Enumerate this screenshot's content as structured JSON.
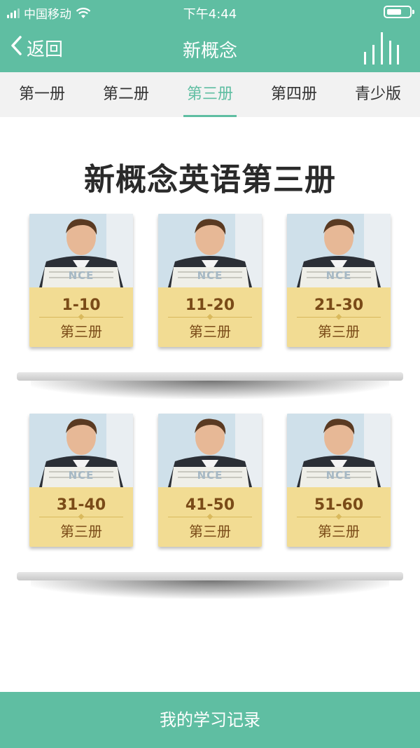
{
  "status_bar": {
    "carrier": "中国移动",
    "time": "下午4:44",
    "signal_icon": "signal-bars-icon",
    "wifi_icon": "wifi-icon",
    "battery_icon": "battery-icon"
  },
  "nav": {
    "back_label": "返回",
    "back_icon": "chevron-left-icon",
    "title": "新概念",
    "menu_icon": "audio-bars-icon"
  },
  "tabs": [
    {
      "label": "第一册",
      "active": false
    },
    {
      "label": "第二册",
      "active": false
    },
    {
      "label": "第三册",
      "active": true
    },
    {
      "label": "第四册",
      "active": false
    },
    {
      "label": "青少版",
      "active": false
    }
  ],
  "page_heading": "新概念英语第三册",
  "books": [
    {
      "cover_text": "NCE",
      "range": "1-10",
      "volume": "第三册"
    },
    {
      "cover_text": "NCE",
      "range": "11-20",
      "volume": "第三册"
    },
    {
      "cover_text": "NCE",
      "range": "21-30",
      "volume": "第三册"
    },
    {
      "cover_text": "NCE",
      "range": "31-40",
      "volume": "第三册"
    },
    {
      "cover_text": "NCE",
      "range": "41-50",
      "volume": "第三册"
    },
    {
      "cover_text": "NCE",
      "range": "51-60",
      "volume": "第三册"
    }
  ],
  "bottom_bar": {
    "label": "我的学习记录"
  },
  "colors": {
    "accent": "#5fbea2",
    "cover_band": "#f2dc93",
    "cover_text": "#7a4b18"
  }
}
